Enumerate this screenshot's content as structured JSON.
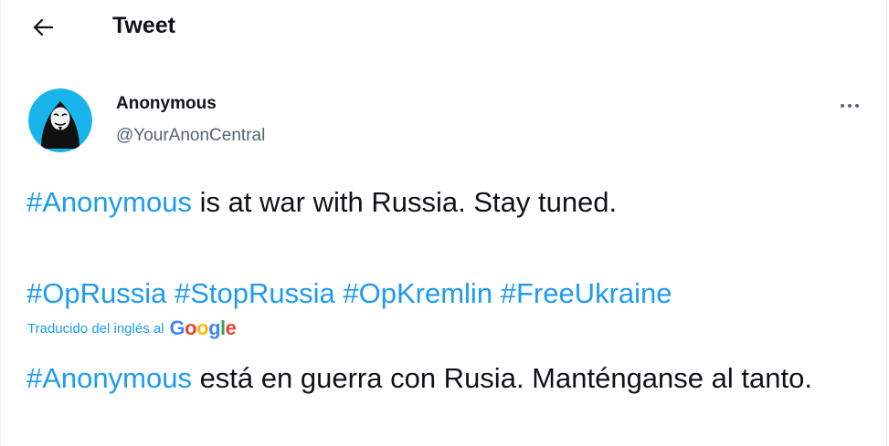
{
  "header": {
    "back_icon": "arrow-left-icon",
    "title": "Tweet"
  },
  "tweet": {
    "author": {
      "display_name": "Anonymous",
      "handle": "@YourAnonCentral",
      "avatar_icon": "anonymous-mask-avatar"
    },
    "more_icon": "more-horizontal-icon",
    "original": {
      "line1": {
        "hashtag": "#Anonymous",
        "rest": " is at war with Russia. Stay tuned."
      },
      "hashtags": [
        "#OpRussia",
        "#StopRussia",
        "#OpKremlin",
        "#FreeUkraine"
      ]
    },
    "translation_notice": {
      "label": "Traducido del inglés al",
      "provider_letters": [
        "G",
        "o",
        "o",
        "g",
        "l",
        "e"
      ],
      "provider_colors": [
        "#4285F4",
        "#EA4335",
        "#FBBC05",
        "#4285F4",
        "#34A853",
        "#EA4335"
      ]
    },
    "translation": {
      "hashtag": "#Anonymous",
      "rest": " está en guerra con Rusia. Manténganse al tanto."
    }
  },
  "colors": {
    "link": "#1d9bf0",
    "text": "#0f1419",
    "secondary": "#536471"
  }
}
